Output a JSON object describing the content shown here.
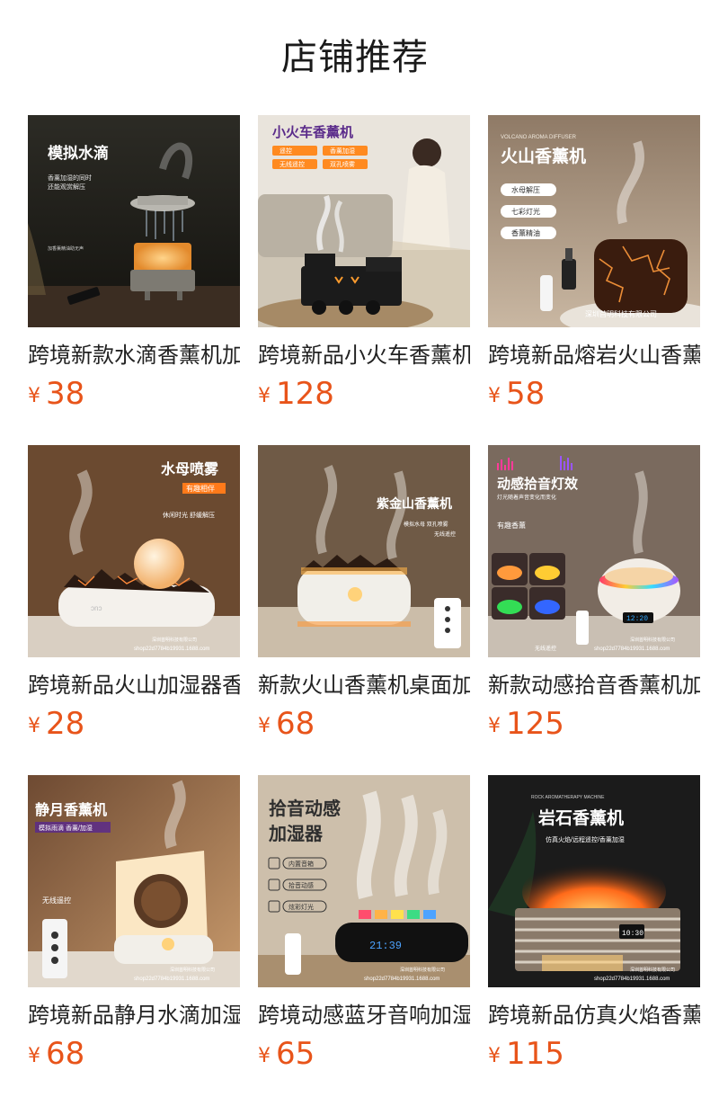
{
  "section": {
    "title": "店铺推荐"
  },
  "products": [
    {
      "name": "跨境新款水滴香薰机加湿器",
      "currency": "¥",
      "price": "38",
      "image": {
        "heading": "模拟水滴",
        "sub": [
          "香薰加湿的同时",
          "还能观赏解压"
        ],
        "note": "加香薰精油助无声"
      }
    },
    {
      "name": "跨境新品小火车香薰机",
      "currency": "¥",
      "price": "128",
      "image": {
        "heading": "小火车香薰机",
        "tags": [
          "遥控",
          "香薰加湿",
          "无线遥控",
          "双孔喷雾"
        ]
      }
    },
    {
      "name": "跨境新品熔岩火山香薰机",
      "currency": "¥",
      "price": "58",
      "image": {
        "eyebrow": "VOLCANO AROMA DIFFUSER",
        "heading": "火山香薰机",
        "tags": [
          "水母解压",
          "七彩灯光",
          "香薰精油"
        ],
        "footer": "深圳首明科技有限公司"
      }
    },
    {
      "name": "跨境新品火山加湿器香薰",
      "currency": "¥",
      "price": "28",
      "image": {
        "heading": "水母喷雾",
        "badge": "有趣相伴",
        "sub": [
          "休闲时光  舒缓解压"
        ],
        "footer": "深圳首明科技有限公司",
        "url": "shop22d7784b19931.1688.com"
      }
    },
    {
      "name": "新款火山香薰机桌面加湿器",
      "currency": "¥",
      "price": "68",
      "image": {
        "heading": "紫金山香薰机",
        "sub": [
          "模拟水母  双孔喷雾",
          "无线遥控"
        ]
      }
    },
    {
      "name": "新款动感拾音香薰机加湿器",
      "currency": "¥",
      "price": "125",
      "image": {
        "heading": "动感拾音灯效",
        "sub": [
          "灯光随着声音变化而变化"
        ],
        "note": "有趣香薰",
        "remote": "无线遥控",
        "display": "12:20",
        "footer": "深圳首明科技有限公司",
        "url": "shop22d7784b19931.1688.com"
      }
    },
    {
      "name": "跨境新品静月水滴加湿器",
      "currency": "¥",
      "price": "68",
      "image": {
        "heading": "静月香薰机",
        "badge": "模拟雨滴  香薰/加湿",
        "remote": "无线遥控",
        "footer": "深圳首明科技有限公司",
        "url": "shop22d7784b19931.1688.com"
      }
    },
    {
      "name": "跨境动感蓝牙音响加湿器",
      "currency": "¥",
      "price": "65",
      "image": {
        "heading": [
          "拾音动感",
          "加湿器"
        ],
        "tags": [
          "内置音箱",
          "拾音动感",
          "炫彩灯光"
        ],
        "display": "21:39",
        "footer": "深圳首明科技有限公司",
        "url": "shop22d7784b19931.1688.com"
      }
    },
    {
      "name": "跨境新品仿真火焰香薰机",
      "currency": "¥",
      "price": "115",
      "image": {
        "eyebrow": "ROCK AROMATHERAPY MACHINE",
        "heading": "岩石香薰机",
        "sub": [
          "仿真火焰/远程遥控/香薰加湿"
        ],
        "display": "10:30",
        "footer": "深圳首明科技有限公司",
        "url": "shop22d7784b19931.1688.com"
      }
    }
  ],
  "colors": {
    "price": "#e8541a",
    "title": "#1a1a1a"
  }
}
